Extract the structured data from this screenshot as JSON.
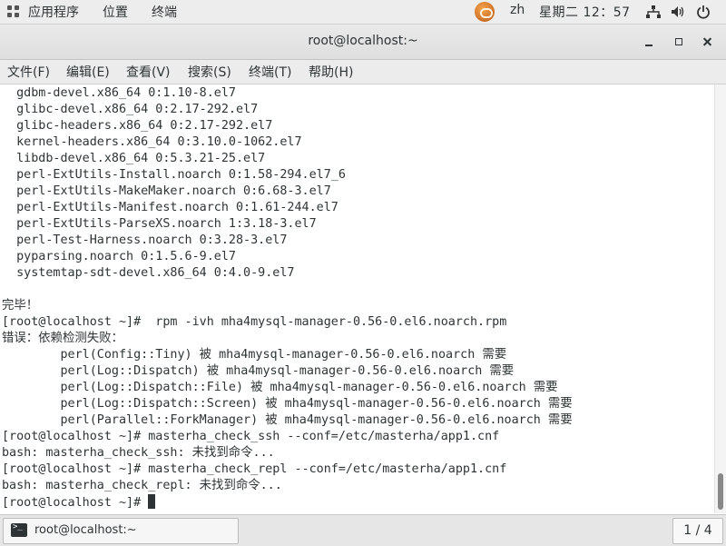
{
  "topbar": {
    "apps_label": "应用程序",
    "places_label": "位置",
    "terminal_label": "终端",
    "lang": "zh",
    "clock": "星期二 12：57"
  },
  "window": {
    "title": "root@localhost:~"
  },
  "menu": {
    "items": [
      "文件(F)",
      "编辑(E)",
      "查看(V)",
      "搜索(S)",
      "终端(T)",
      "帮助(H)"
    ]
  },
  "terminal": {
    "lines": [
      "  gdbm-devel.x86_64 0:1.10-8.el7",
      "  glibc-devel.x86_64 0:2.17-292.el7",
      "  glibc-headers.x86_64 0:2.17-292.el7",
      "  kernel-headers.x86_64 0:3.10.0-1062.el7",
      "  libdb-devel.x86_64 0:5.3.21-25.el7",
      "  perl-ExtUtils-Install.noarch 0:1.58-294.el7_6",
      "  perl-ExtUtils-MakeMaker.noarch 0:6.68-3.el7",
      "  perl-ExtUtils-Manifest.noarch 0:1.61-244.el7",
      "  perl-ExtUtils-ParseXS.noarch 1:3.18-3.el7",
      "  perl-Test-Harness.noarch 0:3.28-3.el7",
      "  pyparsing.noarch 0:1.5.6-9.el7",
      "  systemtap-sdt-devel.x86_64 0:4.0-9.el7",
      "",
      "完毕！",
      "[root@localhost ~]#  rpm -ivh mha4mysql-manager-0.56-0.el6.noarch.rpm",
      "错误：依赖检测失败：",
      "        perl(Config::Tiny) 被 mha4mysql-manager-0.56-0.el6.noarch 需要",
      "        perl(Log::Dispatch) 被 mha4mysql-manager-0.56-0.el6.noarch 需要",
      "        perl(Log::Dispatch::File) 被 mha4mysql-manager-0.56-0.el6.noarch 需要",
      "        perl(Log::Dispatch::Screen) 被 mha4mysql-manager-0.56-0.el6.noarch 需要",
      "        perl(Parallel::ForkManager) 被 mha4mysql-manager-0.56-0.el6.noarch 需要",
      "[root@localhost ~]# masterha_check_ssh --conf=/etc/masterha/app1.cnf",
      "bash: masterha_check_ssh: 未找到命令...",
      "[root@localhost ~]# masterha_check_repl --conf=/etc/masterha/app1.cnf",
      "bash: masterha_check_repl: 未找到命令...",
      "[root@localhost ~]# "
    ]
  },
  "taskbar": {
    "task_label": "root@localhost:~",
    "pager": "1 / 4"
  },
  "icons": {
    "apps": "apps-grid-icon",
    "hand": "input-method-icon",
    "network": "network-icon",
    "volume": "volume-icon",
    "power": "power-icon",
    "terminal": "terminal-icon"
  }
}
